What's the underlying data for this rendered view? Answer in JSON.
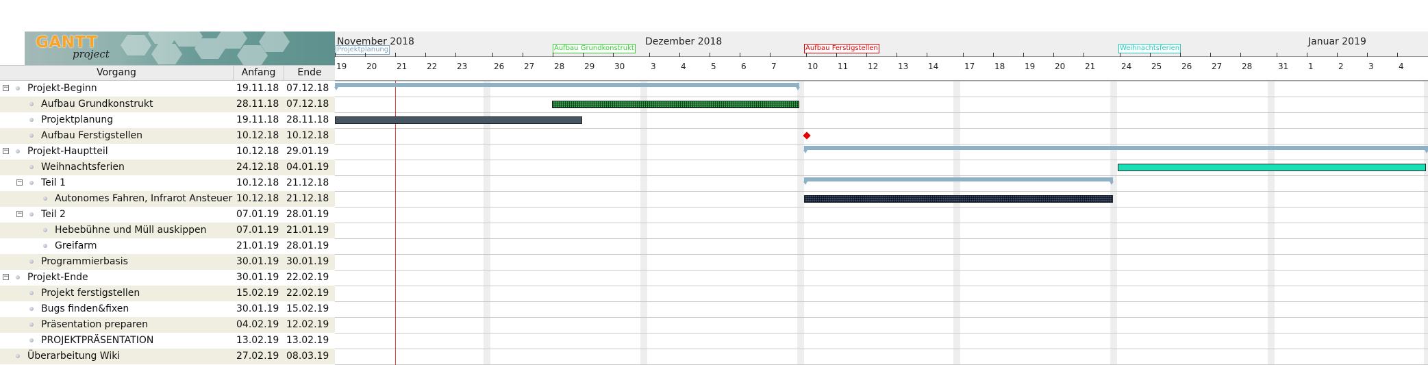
{
  "app": {
    "logo_text": "GANTT",
    "logo_sub": "project"
  },
  "table": {
    "headers": {
      "name": "Vorgang",
      "start": "Anfang",
      "end": "Ende"
    },
    "rows": [
      {
        "name": "Projekt-Beginn",
        "start": "19.11.18",
        "end": "07.12.18",
        "level": 0,
        "expandable": true
      },
      {
        "name": "Aufbau Grundkonstrukt",
        "start": "28.11.18",
        "end": "07.12.18",
        "level": 1,
        "expandable": false
      },
      {
        "name": "Projektplanung",
        "start": "19.11.18",
        "end": "28.11.18",
        "level": 1,
        "expandable": false
      },
      {
        "name": "Aufbau Ferstigstellen",
        "start": "10.12.18",
        "end": "10.12.18",
        "level": 1,
        "expandable": false
      },
      {
        "name": "Projekt-Hauptteil",
        "start": "10.12.18",
        "end": "29.01.19",
        "level": 0,
        "expandable": true
      },
      {
        "name": "Weihnachtsferien",
        "start": "24.12.18",
        "end": "04.01.19",
        "level": 1,
        "expandable": false
      },
      {
        "name": "Teil 1",
        "start": "10.12.18",
        "end": "21.12.18",
        "level": 1,
        "expandable": true
      },
      {
        "name": "Autonomes Fahren, Infrarot Ansteuern",
        "start": "10.12.18",
        "end": "21.12.18",
        "level": 2,
        "expandable": false
      },
      {
        "name": "Teil 2",
        "start": "07.01.19",
        "end": "28.01.19",
        "level": 1,
        "expandable": true
      },
      {
        "name": "Hebebühne und Müll auskippen",
        "start": "07.01.19",
        "end": "21.01.19",
        "level": 2,
        "expandable": false
      },
      {
        "name": "Greifarm",
        "start": "21.01.19",
        "end": "28.01.19",
        "level": 2,
        "expandable": false
      },
      {
        "name": "Programmierbasis",
        "start": "30.01.19",
        "end": "30.01.19",
        "level": 1,
        "expandable": false
      },
      {
        "name": "Projekt-Ende",
        "start": "30.01.19",
        "end": "22.02.19",
        "level": 0,
        "expandable": true
      },
      {
        "name": "Projekt ferstigstellen",
        "start": "15.02.19",
        "end": "22.02.19",
        "level": 1,
        "expandable": false
      },
      {
        "name": "Bugs finden&fixen",
        "start": "30.01.19",
        "end": "15.02.19",
        "level": 1,
        "expandable": false
      },
      {
        "name": "Präsentation preparen",
        "start": "04.02.19",
        "end": "12.02.19",
        "level": 1,
        "expandable": false
      },
      {
        "name": "PROJEKTPRÄSENTATION",
        "start": "13.02.19",
        "end": "13.02.19",
        "level": 1,
        "expandable": false
      },
      {
        "name": "Überarbeitung Wiki",
        "start": "27.02.19",
        "end": "08.03.19",
        "level": 0,
        "expandable": false
      }
    ]
  },
  "timeline": {
    "months": [
      "November 2018",
      "Dezember 2018",
      "Januar 2019"
    ],
    "milestone_flags": [
      {
        "label": "Projektplanung",
        "color": "#7fa6c2"
      },
      {
        "label": "Aufbau Grundkonstrukt",
        "color": "#33cc33"
      },
      {
        "label": "Aufbau Ferstigstellen",
        "color": "#dd0000"
      },
      {
        "label": "Weihnachtsferien",
        "color": "#22ccbb"
      }
    ],
    "days": [
      "19",
      "20",
      "21",
      "22",
      "23",
      "26",
      "27",
      "28",
      "29",
      "30",
      "3",
      "4",
      "5",
      "6",
      "7",
      "10",
      "11",
      "12",
      "13",
      "14",
      "17",
      "18",
      "19",
      "20",
      "21",
      "24",
      "25",
      "26",
      "27",
      "28",
      "31",
      "1",
      "2",
      "3",
      "4"
    ]
  },
  "colors": {
    "summary": "#8fb1c8",
    "grundkonstrukt": "#2fa84a",
    "projektplanung": "#465763",
    "weihnachtsferien": "#19dfb7",
    "autonomes": "#3a4a6a",
    "milestone": "#e00000",
    "today": "#e24343"
  },
  "icons": {
    "expander": "collapse-toggle-icon",
    "bullet": "task-bullet-icon",
    "milestone": "milestone-diamond-icon"
  }
}
